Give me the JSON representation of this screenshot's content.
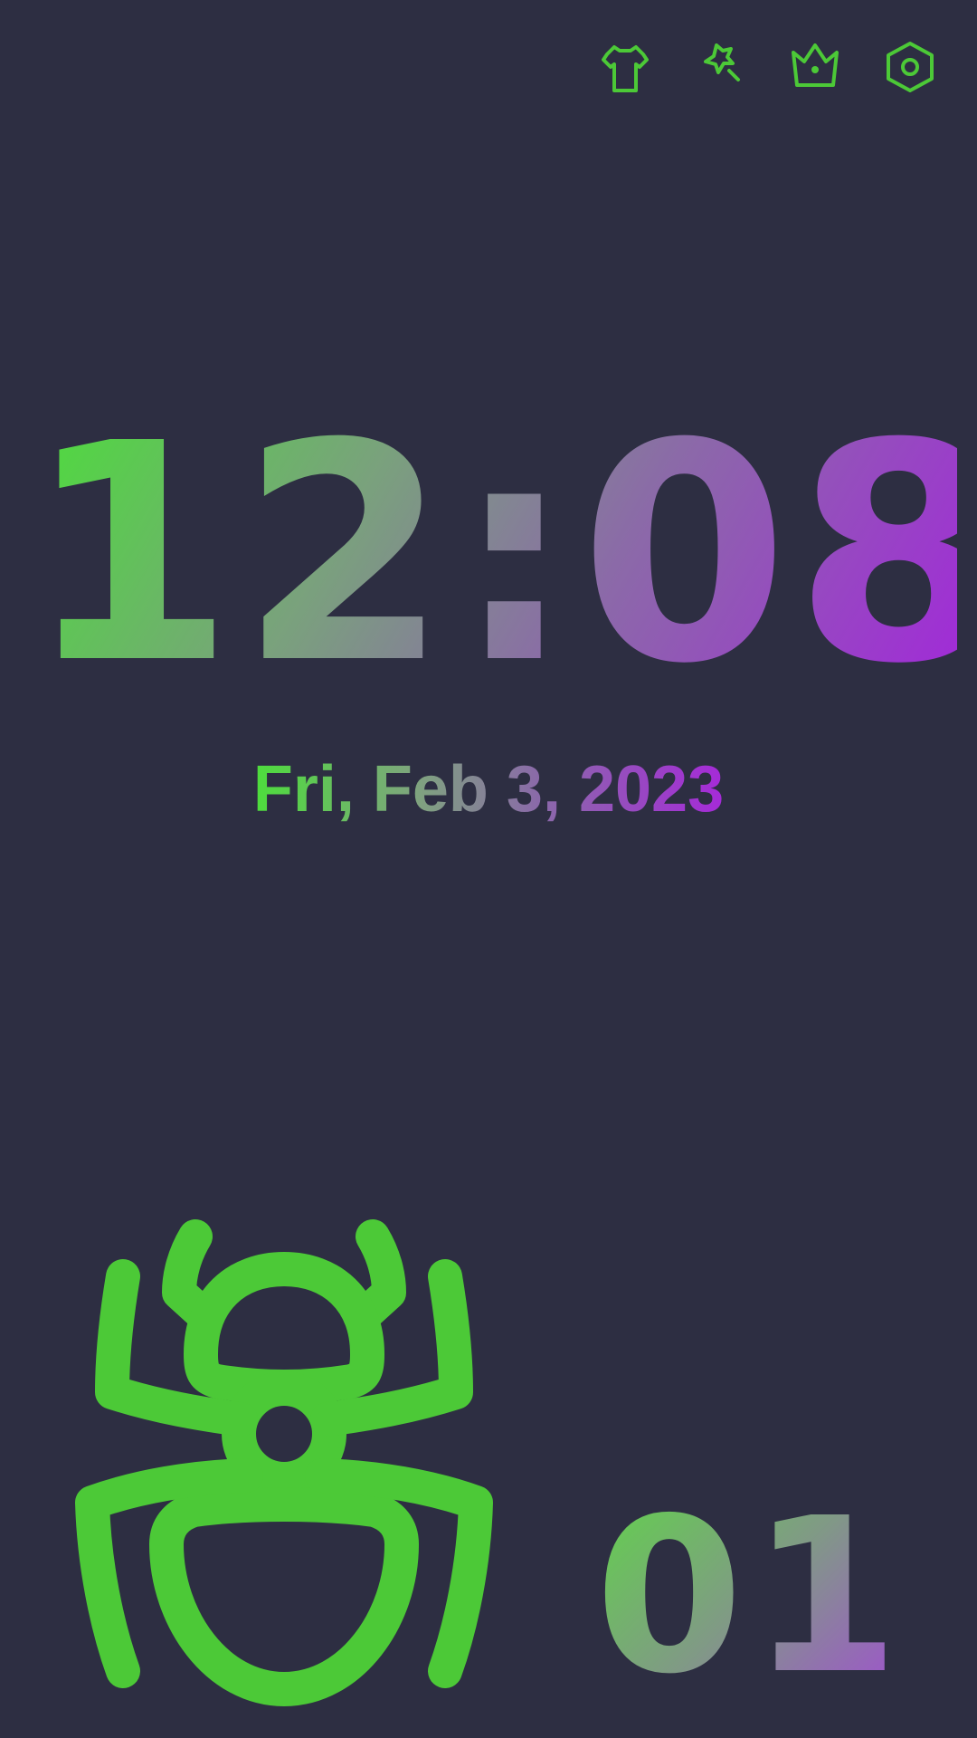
{
  "colors": {
    "background": "#2d2e42",
    "accent_green": "#4cc937",
    "accent_purple": "#a12ad8"
  },
  "toolbar": {
    "icons": [
      "shirt-icon",
      "magic-wand-icon",
      "crown-icon",
      "settings-icon"
    ]
  },
  "clock": {
    "time": "12:08"
  },
  "date": {
    "text": "Fri, Feb 3, 2023"
  },
  "character": {
    "icon": "bug-icon"
  },
  "level": {
    "value": "01"
  }
}
